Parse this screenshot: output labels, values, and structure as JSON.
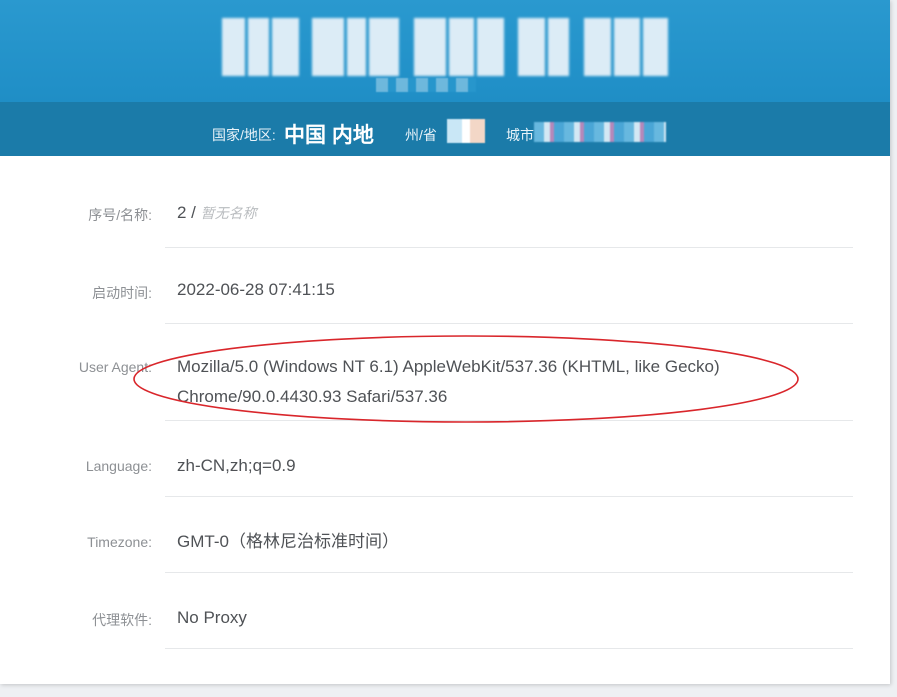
{
  "banner": {
    "ip_text": ""
  },
  "location": {
    "country_label": "国家/地区:",
    "country_value": "中国 内地",
    "province_label": "州/省",
    "city_label": "城市"
  },
  "details": [
    {
      "label": "序号/名称:",
      "value": "2 / ",
      "value_muted": "暂无名称"
    },
    {
      "label": "启动时间:",
      "value": "2022-06-28 07:41:15"
    },
    {
      "label": "User Agent:",
      "value_line1": "Mozilla/5.0 (Windows NT 6.1) AppleWebKit/537.36 (KHTML, like Gecko)",
      "value_line2": "Chrome/90.0.4430.93 Safari/537.36"
    },
    {
      "label": "Language:",
      "value": "zh-CN,zh;q=0.9"
    },
    {
      "label": "Timezone:",
      "value": "GMT-0（格林尼治标准时间）"
    },
    {
      "label": "代理软件:",
      "value": "No Proxy"
    }
  ],
  "annotation": {
    "color": "#d9262b"
  },
  "colors": {
    "banner": "#2196cd",
    "location_bar": "#1b7ba9"
  }
}
